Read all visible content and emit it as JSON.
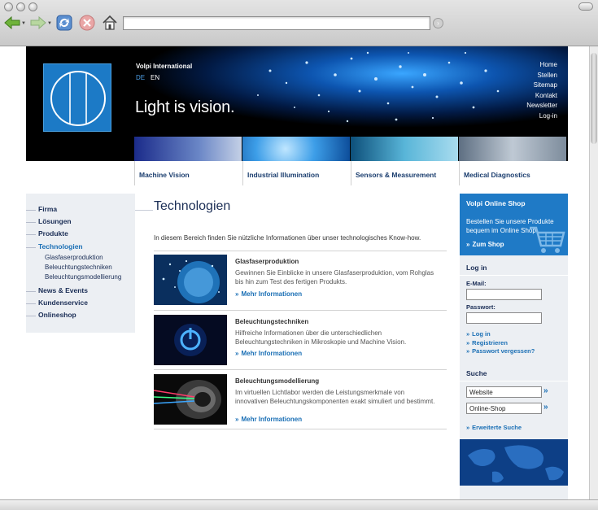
{
  "header": {
    "brand": "Volpi International",
    "lang_de": "DE",
    "lang_en": "EN",
    "slogan": "Light is vision.",
    "meta_nav": [
      "Home",
      "Stellen",
      "Sitemap",
      "Kontakt",
      "Newsletter",
      "Log-in"
    ]
  },
  "categories": [
    "Machine Vision",
    "Industrial Illumination",
    "Sensors & Measurement",
    "Medical Diagnostics"
  ],
  "leftnav": {
    "firma": "Firma",
    "loesungen": "Lösungen",
    "produkte": "Produkte",
    "technologien": "Technologien",
    "sub": [
      "Glasfaserproduktion",
      "Beleuchtungstechniken",
      "Beleuchtungsmodellierung"
    ],
    "news": "News & Events",
    "kundenservice": "Kundenservice",
    "onlineshop": "Onlineshop"
  },
  "main": {
    "title": "Technologien",
    "intro": "In diesem Bereich finden Sie nützliche Informationen über unser technologisches Know-how.",
    "articles": [
      {
        "title": "Glasfaserproduktion",
        "text": "Gewinnen Sie Einblicke in unsere Glasfaserproduktion, vom Rohglas bis hin zum Test des fertigen Produkts.",
        "link": "Mehr Informationen"
      },
      {
        "title": "Beleuchtungstechniken",
        "text": "Hilfreiche Informationen über die unterschiedlichen Beleuchtungstechniken in Mikroskopie und Machine Vision.",
        "link": "Mehr Informationen"
      },
      {
        "title": "Beleuchtungsmodellierung",
        "text": "Im virtuellen Lichtlabor werden die Leistungsmerkmale von innovativen Beleuchtungskomponenten exakt simuliert und bestimmt.",
        "link": "Mehr Informationen"
      }
    ]
  },
  "shop": {
    "title": "Volpi Online Shop",
    "text": "Bestellen Sie unsere Produkte bequem im Online Shop.",
    "link": "Zum Shop"
  },
  "login": {
    "title": "Log in",
    "email_label": "E-Mail:",
    "password_label": "Passwort:",
    "login_link": "Log in",
    "register_link": "Registrieren",
    "forgot_link": "Passwort vergessen?"
  },
  "search": {
    "title": "Suche",
    "option1": "Website",
    "option2": "Online-Shop",
    "advanced_link": "Erweiterte Suche"
  },
  "raquo": "»",
  "colors": {
    "brand_blue": "#1f7ac6",
    "link_blue": "#1a6fb5",
    "navy": "#1a2d55",
    "panel_gray": "#eceff3"
  },
  "icons": [
    "back-arrow-icon",
    "forward-arrow-icon",
    "reload-icon",
    "stop-icon",
    "home-icon",
    "shopping-cart-icon"
  ]
}
